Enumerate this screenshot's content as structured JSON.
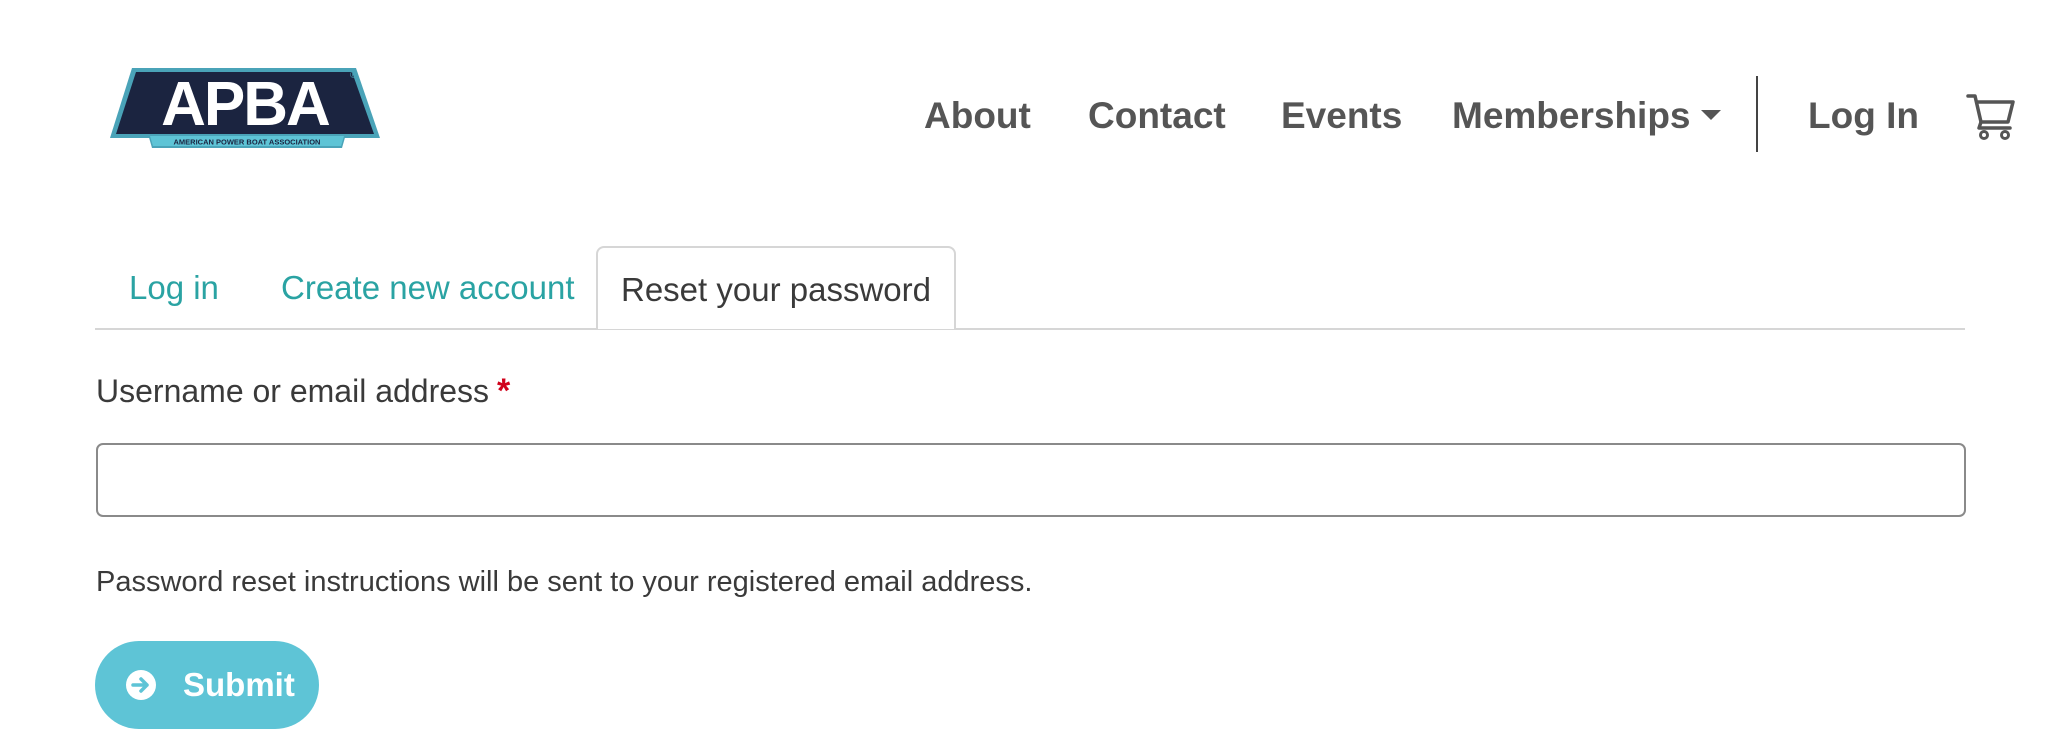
{
  "header": {
    "logo": {
      "text": "APBA",
      "subtitle": "AMERICAN POWER BOAT ASSOCIATION",
      "icon": "apba-logo"
    },
    "nav": {
      "about": "About",
      "contact": "Contact",
      "events": "Events",
      "memberships": "Memberships",
      "login": "Log In",
      "cart_icon": "shopping-cart-icon"
    }
  },
  "tabs": [
    {
      "label": "Log in",
      "active": false
    },
    {
      "label": "Create new account",
      "active": false
    },
    {
      "label": "Reset your password",
      "active": true
    }
  ],
  "form": {
    "field_label": "Username or email address",
    "required_marker": "*",
    "input_value": "",
    "help_text": "Password reset instructions will be sent to your registered email address.",
    "submit_label": "Submit",
    "submit_icon": "arrow-circle-right-icon"
  },
  "colors": {
    "accent_link": "#2aa3a3",
    "button_bg": "#5ec4d6",
    "required": "#d0021b",
    "logo_navy": "#1b2440",
    "logo_cyan": "#4aa3b8"
  }
}
